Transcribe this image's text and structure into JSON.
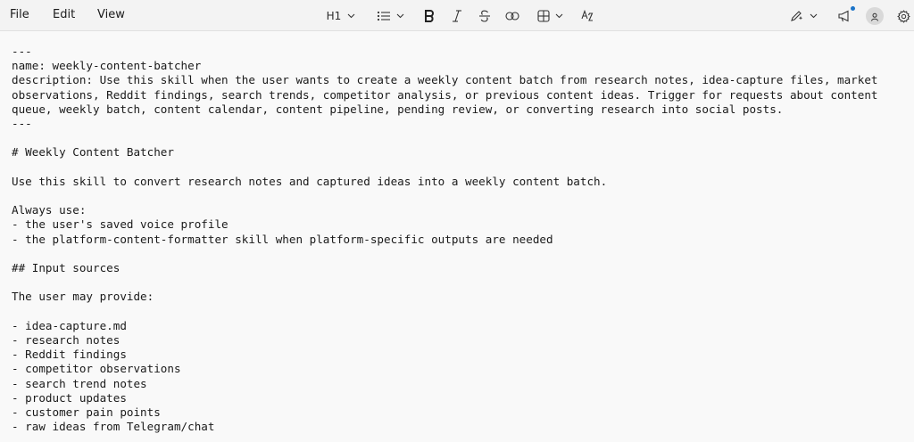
{
  "menu": {
    "file": "File",
    "edit": "Edit",
    "view": "View"
  },
  "toolbar": {
    "heading_level": "H1",
    "icons": [
      "list-icon",
      "bold-icon",
      "italic-icon",
      "strikethrough-icon",
      "link-icon",
      "table-icon",
      "spellcheck-icon",
      "copilot-pen-icon",
      "megaphone-icon",
      "account-icon",
      "settings-icon"
    ]
  },
  "document": {
    "text": "---\nname: weekly-content-batcher\ndescription: Use this skill when the user wants to create a weekly content batch from research notes, idea-capture files, market observations, Reddit findings, search trends, competitor analysis, or previous content ideas. Trigger for requests about content queue, weekly batch, content calendar, content pipeline, pending review, or converting research into social posts.\n---\n\n# Weekly Content Batcher\n\nUse this skill to convert research notes and captured ideas into a weekly content batch.\n\nAlways use:\n- the user's saved voice profile\n- the platform-content-formatter skill when platform-specific outputs are needed\n\n## Input sources\n\nThe user may provide:\n\n- idea-capture.md\n- research notes\n- Reddit findings\n- competitor observations\n- search trend notes\n- product updates\n- customer pain points\n- raw ideas from Telegram/chat"
  }
}
